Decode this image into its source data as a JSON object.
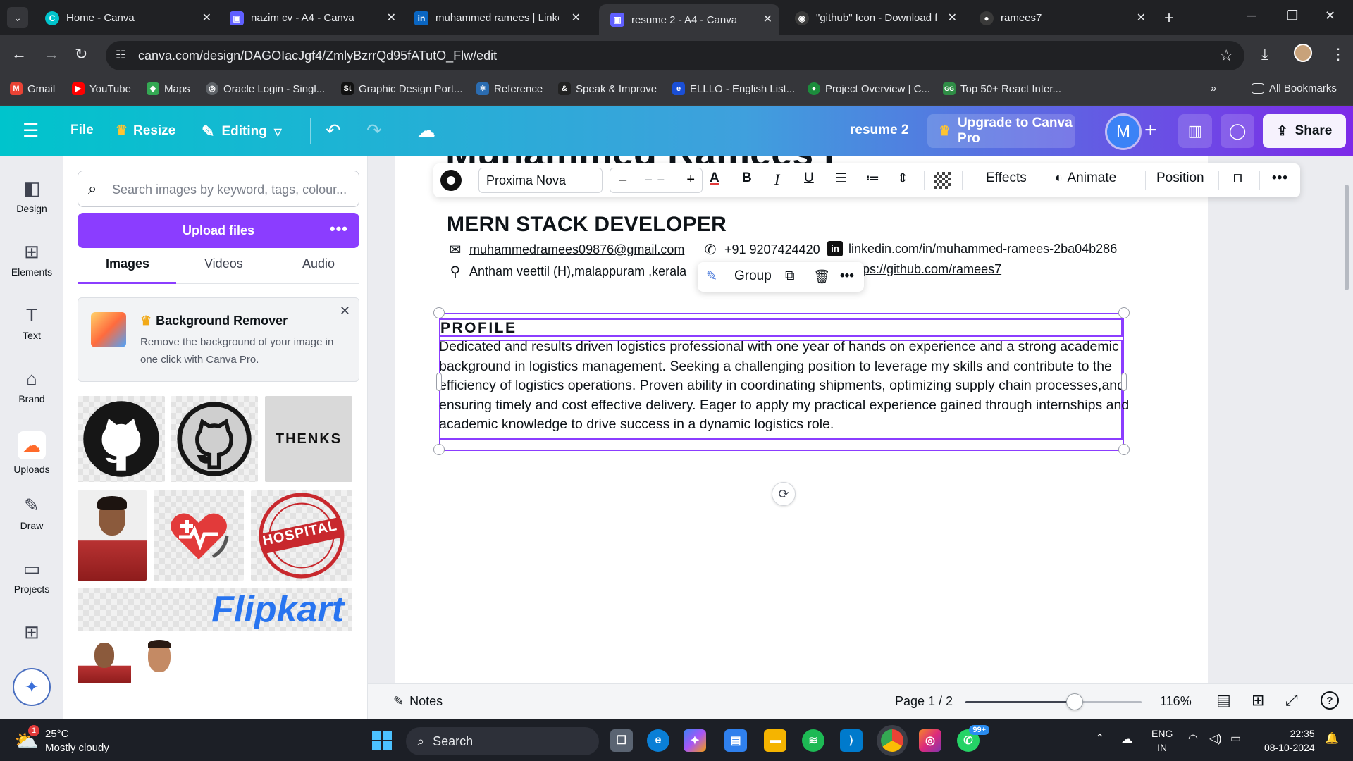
{
  "browser": {
    "tabs": [
      {
        "label": "Home - Canva",
        "icon": "canva-icon",
        "color": "#00c4cc",
        "glyph": "C",
        "active": false
      },
      {
        "label": "nazim cv - A4 - Canva",
        "icon": "canva-doc-icon",
        "color": "#5f5fff",
        "glyph": "▣",
        "active": false
      },
      {
        "label": "muhammed ramees | LinkedIn",
        "icon": "linkedin-icon",
        "color": "#0a66c2",
        "glyph": "in",
        "active": false
      },
      {
        "label": "resume 2 - A4 - Canva",
        "icon": "canva-doc-icon",
        "color": "#5f5fff",
        "glyph": "▣",
        "active": true
      },
      {
        "label": "\"github\" Icon - Download f",
        "icon": "icons8-icon",
        "color": "#3a3a3a",
        "glyph": "◉",
        "active": false
      },
      {
        "label": "ramees7",
        "icon": "github-icon",
        "color": "#3a3a3a",
        "glyph": "●",
        "active": false
      }
    ],
    "url": "canva.com/design/DAGOIacJgf4/ZmlyBzrrQd95fATutO_Flw/edit",
    "bookmarks": [
      {
        "label": "Gmail",
        "color": "#ea4335",
        "glyph": "M"
      },
      {
        "label": "YouTube",
        "color": "#ff0000",
        "glyph": "▶"
      },
      {
        "label": "Maps",
        "color": "#34a853",
        "glyph": "◆"
      },
      {
        "label": "Oracle Login - Singl...",
        "color": "#5f6368",
        "glyph": "◎"
      },
      {
        "label": "Graphic Design Port...",
        "color": "#111111",
        "glyph": "St"
      },
      {
        "label": "Reference",
        "color": "#2b6cb0",
        "glyph": "⚛"
      },
      {
        "label": "Speak & Improve",
        "color": "#222222",
        "glyph": "&"
      },
      {
        "label": "ELLLO - English List...",
        "color": "#1a4fd6",
        "glyph": "e"
      },
      {
        "label": "Project Overview | C...",
        "color": "#1c8c3c",
        "glyph": "●"
      },
      {
        "label": "Top 50+ React Inter...",
        "color": "#2f8d46",
        "glyph": "GG"
      }
    ],
    "all_bookmarks": "All Bookmarks"
  },
  "canva": {
    "file": "File",
    "resize": "Resize",
    "editing": "Editing",
    "doc_title": "resume 2",
    "upgrade": "Upgrade to Canva Pro",
    "avatar_initial": "M",
    "share": "Share",
    "rail": [
      "Design",
      "Elements",
      "Text",
      "Brand",
      "Uploads",
      "Draw",
      "Projects"
    ],
    "panel": {
      "search_placeholder": "Search images by keyword, tags, colour...",
      "upload": "Upload files",
      "tabs": [
        "Images",
        "Videos",
        "Audio"
      ],
      "promo_title": "Background Remover",
      "promo_desc": "Remove the background of your image in one click with Canva Pro.",
      "thenks": "THENKS",
      "hospital": "HOSPITAL",
      "flipkart": "Flipkart"
    },
    "toolbar": {
      "font": "Proxima Nova",
      "size": "– –",
      "effects": "Effects",
      "animate": "Animate",
      "position": "Position"
    },
    "group_bar": {
      "label": "Group"
    },
    "page": {
      "name_partial": "Muhammed Ramees P",
      "role": "MERN STACK DEVELOPER",
      "email": "muhammedramees09876@gmail.com",
      "phone": "+91 9207424420",
      "linkedin": "linkedin.com/in/muhammed-ramees-2ba04b286",
      "address": "Antham veettil (H),malappuram ,kerala",
      "github": "https://github.com/ramees7",
      "github_visible": "ps://github.com/ramees7",
      "profile_heading": "PROFILE",
      "profile_text": "Dedicated and results driven logistics professional with one year of hands on experience and a strong academic background in logistics management. Seeking a challenging position to leverage my skills and contribute to the efficiency of logistics operations. Proven ability in coordinating shipments, optimizing supply chain processes,and ensuring timely and cost effective delivery. Eager to apply my practical experience gained through internships and academic knowledge to drive success in a dynamic logistics role."
    },
    "bottom": {
      "notes": "Notes",
      "page": "Page 1 / 2",
      "zoom": "116%",
      "zoom_fraction": 0.62
    }
  },
  "taskbar": {
    "temp": "25°C",
    "weather": "Mostly cloudy",
    "weather_badge": "1",
    "search": "Search",
    "lang": "ENG",
    "region": "IN",
    "time": "22:35",
    "date": "08-10-2024",
    "whatsapp_badge": "99+"
  },
  "colors": {
    "canva_purple": "#8b3dff",
    "canva_teal": "#00c4cc",
    "selection": "#8b3dff"
  }
}
